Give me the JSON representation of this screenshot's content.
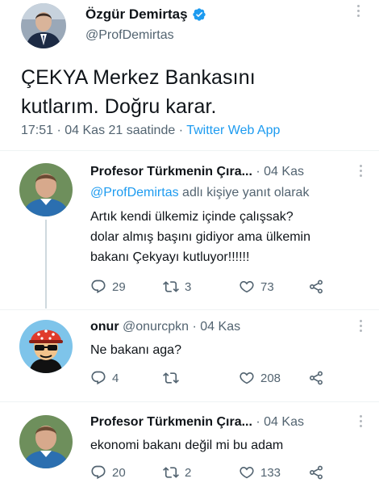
{
  "main_tweet": {
    "display_name": "Özgür Demirtaş",
    "handle": "@ProfDemirtas",
    "text_line1": "ÇEKYA Merkez Bankasını",
    "text_line2": "kutlarım. Doğru karar.",
    "timestamp": "17:51 · 04 Kas 21 saatinde · ",
    "source": "Twitter Web App"
  },
  "replies": [
    {
      "display_name": "Profesor Türkmenin Çıra...",
      "meta": " · 04 Kas",
      "reply_to_handle": "@ProfDemirtas",
      "reply_to_suffix": " adlı kişiye yanıt olarak",
      "lines": [
        "Artık kendi ülkemiz içinde çalışsak?",
        "dolar almış başını gidiyor ama ülkemin",
        "bakanı Çekyayı kutluyor!!!!!!"
      ],
      "reply_count": "29",
      "retweet_count": "3",
      "like_count": "73"
    },
    {
      "display_name": "onur",
      "meta": " @onurcpkn · 04 Kas",
      "lines": [
        "Ne bakanı aga?"
      ],
      "reply_count": "4",
      "retweet_count": "",
      "like_count": "208"
    },
    {
      "display_name": "Profesor Türkmenin Çıra...",
      "meta": " · 04 Kas",
      "lines": [
        "ekonomi bakanı değil mi bu adam"
      ],
      "reply_count": "20",
      "retweet_count": "2",
      "like_count": "133"
    }
  ],
  "colors": {
    "accent": "#1d9bf0",
    "muted": "#536471",
    "text": "#0f1419"
  },
  "icons": [
    "verified-badge-icon",
    "more-dots-icon",
    "reply-icon",
    "retweet-icon",
    "like-icon",
    "share-icon"
  ]
}
